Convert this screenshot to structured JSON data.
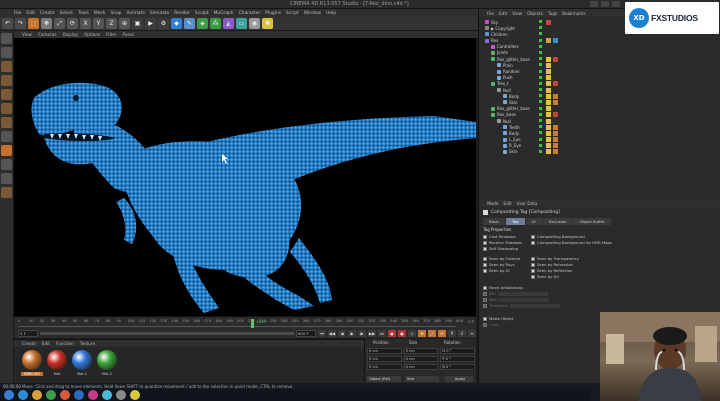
{
  "window": {
    "title": "CINEMA 4D R13.057 Studio - [T-Rex_dino.c4d *]"
  },
  "menubar": [
    "File",
    "Edit",
    "Create",
    "Select",
    "Tools",
    "Mesh",
    "Snap",
    "Animate",
    "Simulate",
    "Render",
    "Sculpt",
    "MoGraph",
    "Character",
    "Plugins",
    "Script",
    "Window",
    "Help"
  ],
  "viewport_menu": [
    "View",
    "Cameras",
    "Display",
    "Options",
    "Filter",
    "Panel"
  ],
  "timeline": {
    "ticks": [
      "0",
      "10",
      "20",
      "30",
      "40",
      "50",
      "60",
      "70",
      "80",
      "90",
      "100",
      "110",
      "120",
      "130",
      "140",
      "150",
      "160",
      "170",
      "180",
      "190",
      "200",
      "210",
      "220",
      "230",
      "240",
      "250",
      "260",
      "270",
      "280",
      "290",
      "300",
      "310",
      "320",
      "330",
      "340",
      "350",
      "360",
      "370",
      "380",
      "390",
      "400"
    ],
    "current_frame": "124 F",
    "end_label": "0 F"
  },
  "transport": {
    "start_field": "0 F",
    "end_field": "600 F"
  },
  "material_menu": [
    "Create",
    "Edit",
    "Function",
    "Texture"
  ],
  "materials": [
    {
      "name": "HDRI 051",
      "color": "#c8702a"
    },
    {
      "name": "Mat",
      "color": "#c93026"
    },
    {
      "name": "Mat.1",
      "color": "#3478d8"
    },
    {
      "name": "Mat.2",
      "color": "#3da53a"
    }
  ],
  "coords": {
    "headers": [
      "Position",
      "Size",
      "Rotation"
    ],
    "rows": [
      {
        "axis": "X",
        "pos": "0 cm",
        "size": "0 cm",
        "rot": "H 0 °"
      },
      {
        "axis": "Y",
        "pos": "0 cm",
        "size": "0 cm",
        "rot": "P 0 °"
      },
      {
        "axis": "Z",
        "pos": "0 cm",
        "size": "0 cm",
        "rot": "B 0 °"
      }
    ],
    "object_mode": "Object (Rel)",
    "size_mode": "Size",
    "apply_label": "Apply"
  },
  "object_manager": {
    "menu": [
      "File",
      "Edit",
      "View",
      "Objects",
      "Tags",
      "Bookmarks"
    ],
    "rows": [
      {
        "label": "Sky",
        "indent": 6,
        "icon": "#d94ad1",
        "tags": [
          "#c44"
        ]
      },
      {
        "label": "▶ Copyright",
        "indent": 6,
        "icon": "#888",
        "tags": []
      },
      {
        "label": "Children",
        "indent": 6,
        "icon": "#5a9bd8",
        "tags": []
      },
      {
        "label": "Rex",
        "indent": 6,
        "icon": "#8b6ccf",
        "tags": [
          "#c8a23a",
          "#3a8fd0"
        ]
      },
      {
        "label": "Controllers",
        "indent": 12,
        "icon": "#c85ad0",
        "tags": []
      },
      {
        "label": "Joints",
        "indent": 12,
        "icon": "#5ab56a",
        "tags": []
      },
      {
        "label": "Rex_glitter_base",
        "indent": 12,
        "icon": "#5ab56a",
        "tags": [
          "#e0c33a",
          "#b84a3a"
        ]
      },
      {
        "label": "Plain",
        "indent": 18,
        "icon": "#7aa7d8",
        "tags": [
          "#e0c33a"
        ]
      },
      {
        "label": "Random",
        "indent": 18,
        "icon": "#7aa7d8",
        "tags": [
          "#e0c33a"
        ]
      },
      {
        "label": "Push",
        "indent": 18,
        "icon": "#7aa7d8",
        "tags": [
          "#e0c33a"
        ]
      },
      {
        "label": "Trex_t",
        "indent": 12,
        "icon": "#5ab56a",
        "tags": [
          "#e0c33a",
          "#b84a3a"
        ]
      },
      {
        "label": "Null",
        "indent": 18,
        "icon": "#999",
        "tags": [
          "#e0c33a"
        ]
      },
      {
        "label": "Body",
        "indent": 24,
        "icon": "#7aa7d8",
        "tags": [
          "#e0c33a",
          "#c97b3a"
        ]
      },
      {
        "label": "Skin",
        "indent": 24,
        "icon": "#7aa7d8",
        "tags": [
          "#e0c33a",
          "#c97b3a"
        ]
      },
      {
        "label": "Rex_glitter_base",
        "indent": 12,
        "icon": "#5ab56a",
        "tags": [
          "#e0c33a"
        ]
      },
      {
        "label": "Rex_base",
        "indent": 12,
        "icon": "#5ab56a",
        "tags": [
          "#e0c33a",
          "#b84a3a"
        ]
      },
      {
        "label": "Null",
        "indent": 18,
        "icon": "#999",
        "tags": [
          "#e0c33a"
        ]
      },
      {
        "label": "Teeth",
        "indent": 24,
        "icon": "#7aa7d8",
        "tags": [
          "#e0c33a",
          "#c97b3a"
        ]
      },
      {
        "label": "Body",
        "indent": 24,
        "icon": "#7aa7d8",
        "tags": [
          "#e0c33a",
          "#c97b3a"
        ]
      },
      {
        "label": "L_Eye",
        "indent": 24,
        "icon": "#7aa7d8",
        "tags": [
          "#e0c33a",
          "#c97b3a"
        ]
      },
      {
        "label": "R_Eye",
        "indent": 24,
        "icon": "#7aa7d8",
        "tags": [
          "#e0c33a",
          "#c97b3a"
        ]
      },
      {
        "label": "Skin",
        "indent": 24,
        "icon": "#7aa7d8",
        "tags": [
          "#e0c33a",
          "#c97b3a"
        ]
      }
    ]
  },
  "attributes": {
    "menu": [
      "Mode",
      "Edit",
      "User Data"
    ],
    "title": "Compositing Tag [Compositing]",
    "tabs": [
      "Basic",
      "Tag",
      "GI",
      "Exclusion",
      "Object Buffer"
    ],
    "active_tab": "Tag",
    "section": "Tag Properties",
    "left_props": [
      "Cast Shadows",
      "Receive Shadows",
      "Self Shadowing",
      "Seen by Camera",
      "Seen by Rays",
      "Seen by GI"
    ],
    "right_props": [
      "Compositing Background",
      "Compositing Background for HDR Maps",
      "Seen by Transparency",
      "Seen by Refraction",
      "Seen by Reflection",
      "Seen by AO"
    ],
    "lower_props": [
      "Force Antialiasing",
      "Min",
      "Max",
      "Threshold",
      "Matte Object",
      "Color"
    ]
  },
  "status": {
    "time": "00:00:00",
    "text": "Move: Click and drag to move elements. Hold down SHIFT to quantize movement / add to the selection in point mode, CTRL to remove."
  },
  "logo": {
    "mark": "XD",
    "brand": "FXSTUDIOS"
  },
  "colors": {
    "accent_blue": "#6e7e9a",
    "viewport_bg": "#000000",
    "dino_blue": "#2a8ad8"
  }
}
